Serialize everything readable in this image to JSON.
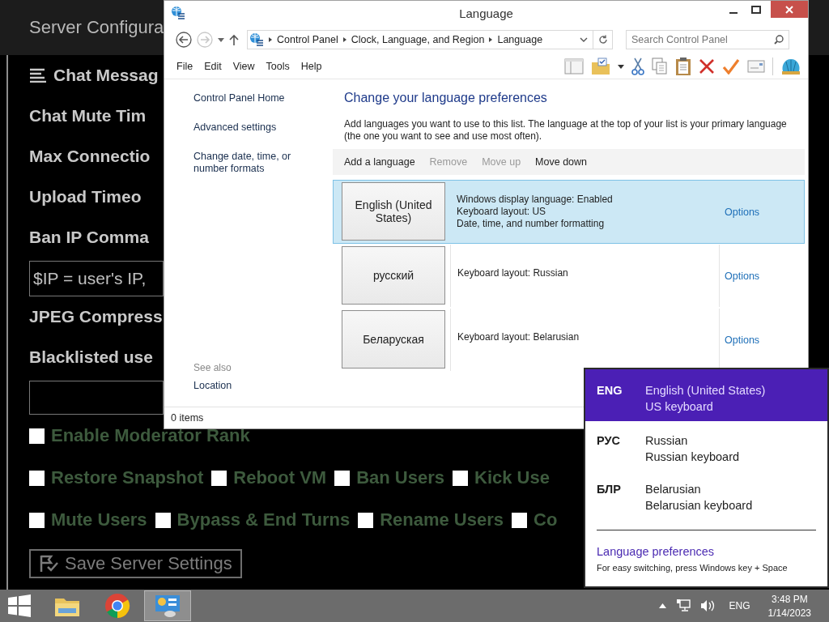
{
  "background_app": {
    "title": "Server Configura",
    "settings": [
      {
        "kind": "heading",
        "text": "Chat Messag"
      },
      {
        "kind": "label",
        "text": "Chat Mute Tim"
      },
      {
        "kind": "label",
        "text": "Max Connectio"
      },
      {
        "kind": "label",
        "text": "Upload Timeo"
      },
      {
        "kind": "label",
        "text": "Ban IP Comma"
      },
      {
        "kind": "field",
        "placeholder": "$IP = user's IP,"
      },
      {
        "kind": "label",
        "text": "JPEG Compress"
      },
      {
        "kind": "label",
        "text": "Blacklisted use"
      },
      {
        "kind": "field"
      },
      {
        "kind": "checkboxes",
        "items": [
          {
            "label": "Enable Moderator Rank",
            "checked": false
          }
        ]
      },
      {
        "kind": "checkboxes",
        "items": [
          {
            "label": "Restore Snapshot",
            "checked": false
          },
          {
            "label": "Reboot VM",
            "checked": false
          },
          {
            "label": "Ban Users",
            "checked": false
          },
          {
            "label": "Kick Use",
            "checked": false
          }
        ]
      },
      {
        "kind": "checkboxes",
        "items": [
          {
            "label": "Mute Users",
            "checked": false
          },
          {
            "label": "Bypass & End Turns",
            "checked": false
          },
          {
            "label": "Rename Users",
            "checked": false
          },
          {
            "label": "Co",
            "checked": false
          }
        ]
      }
    ],
    "save_button": "Save Server Settings"
  },
  "window": {
    "title": "Language",
    "navigation": {
      "back_enabled": true,
      "forward_enabled": false
    },
    "breadcrumb": [
      "Control Panel",
      "Clock, Language, and Region",
      "Language"
    ],
    "search": {
      "placeholder": "Search Control Panel"
    },
    "menu": [
      "File",
      "Edit",
      "View",
      "Tools",
      "Help"
    ],
    "sidebar": {
      "links": [
        "Control Panel Home",
        "Advanced settings",
        "Change date, time, or number formats"
      ],
      "see_also": "See also",
      "see_also_links": [
        "Location"
      ]
    },
    "heading": "Change your language preferences",
    "description": "Add languages you want to use to this list. The language at the top of your list is your primary language (the one you want to see and use most often).",
    "actions": [
      {
        "label": "Add a language",
        "disabled": false
      },
      {
        "label": "Remove",
        "disabled": true
      },
      {
        "label": "Move up",
        "disabled": true
      },
      {
        "label": "Move down",
        "disabled": false
      }
    ],
    "languages": [
      {
        "name": "English (United States)",
        "details": [
          "Windows display language: Enabled",
          "Keyboard layout: US",
          "Date, time, and number formatting"
        ],
        "options": "Options",
        "selected": true
      },
      {
        "name": "русский",
        "details": [
          "Keyboard layout: Russian"
        ],
        "options": "Options",
        "selected": false
      },
      {
        "name": "Беларуская",
        "details": [
          "Keyboard layout: Belarusian"
        ],
        "options": "Options",
        "selected": false
      }
    ],
    "status_bar": "0 items"
  },
  "language_flyout": {
    "items": [
      {
        "code": "ENG",
        "name": "English (United States)",
        "keyboard": "US keyboard",
        "selected": true
      },
      {
        "code": "РУС",
        "name": "Russian",
        "keyboard": "Russian keyboard",
        "selected": false
      },
      {
        "code": "БЛР",
        "name": "Belarusian",
        "keyboard": "Belarusian keyboard",
        "selected": false
      }
    ],
    "link": "Language preferences",
    "hint": "For easy switching, press Windows key + Space"
  },
  "taskbar": {
    "apps": [
      {
        "kind": "file-explorer",
        "active": false
      },
      {
        "kind": "browser",
        "active": false
      },
      {
        "kind": "control-panel",
        "active": true
      }
    ],
    "input_language": "ENG",
    "time": "3:48 PM",
    "date": "1/14/2023"
  }
}
